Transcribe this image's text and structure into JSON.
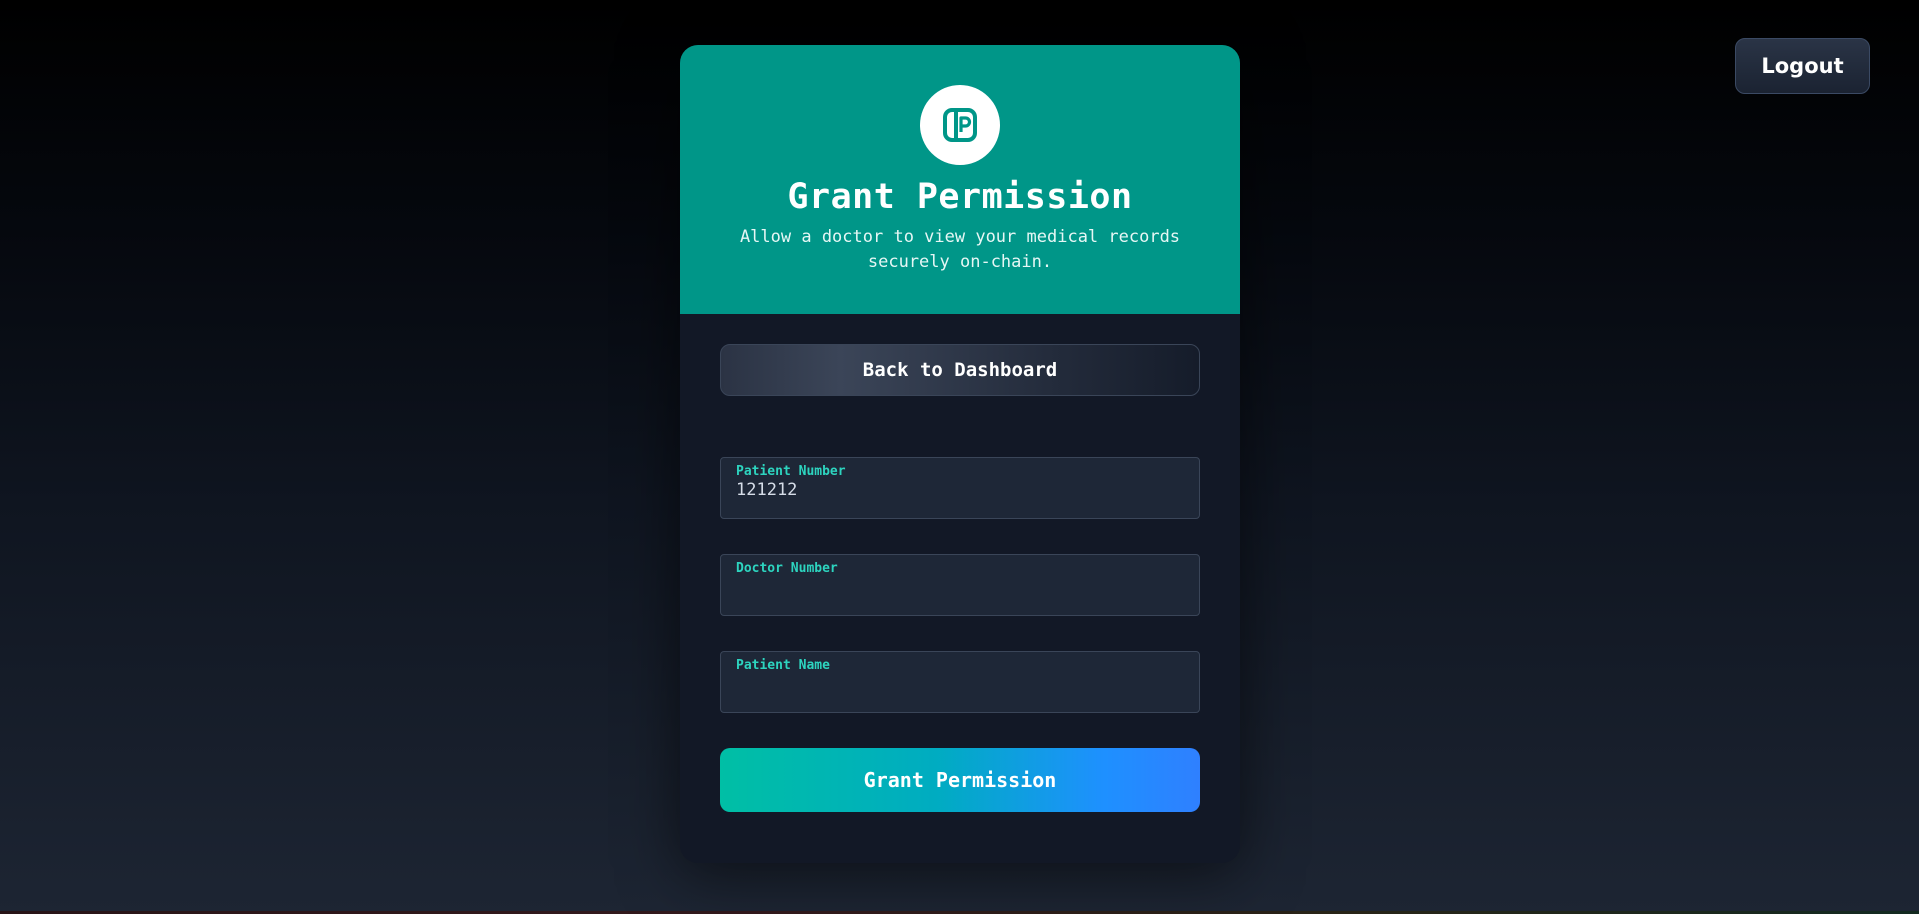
{
  "header": {
    "logout_label": "Logout"
  },
  "card": {
    "icon": "medical-record-icon",
    "title": "Grant Permission",
    "subtitle": "Allow a doctor to view your medical records securely on-chain.",
    "back_label": "Back to Dashboard",
    "fields": [
      {
        "label": "Patient Number",
        "value": "121212",
        "placeholder": ""
      },
      {
        "label": "Doctor Number",
        "value": "",
        "placeholder": ""
      },
      {
        "label": "Patient Name",
        "value": "",
        "placeholder": ""
      }
    ],
    "submit_label": "Grant Permission"
  },
  "colors": {
    "header_bg": "#009688",
    "card_bg": "#121826",
    "field_label": "#2dd4bf",
    "accent_gradient_start": "#00bfa5",
    "accent_gradient_end": "#2f80ff"
  }
}
